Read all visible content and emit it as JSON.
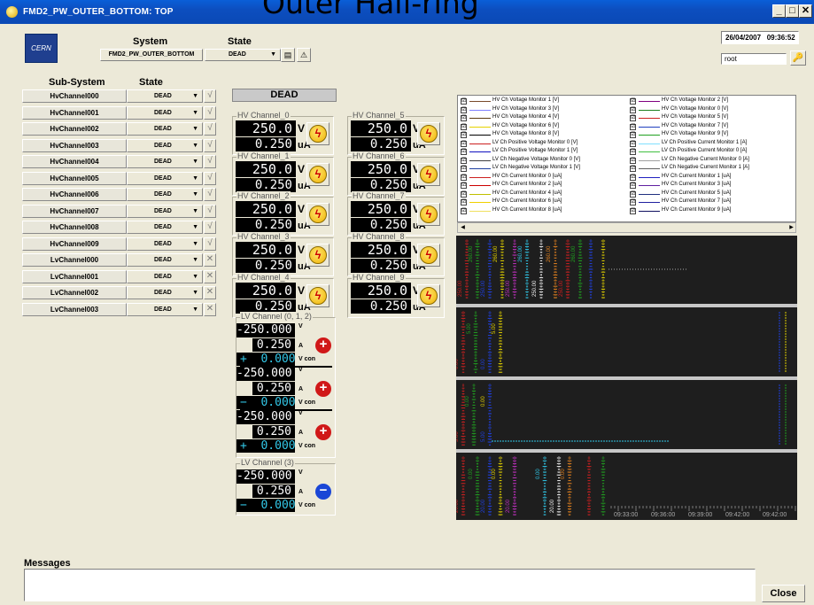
{
  "window": {
    "title": "FMD2_PW_OUTER_BOTTOM: TOP",
    "overlay_title": "Outer Half-ring",
    "min": "_",
    "max": "□",
    "close": "✕"
  },
  "header": {
    "system_label": "System",
    "state_label": "State",
    "system_value": "FMD2_PW_OUTER_BOTTOM",
    "state_value": "DEAD",
    "date": "26/04/2007",
    "time": "09:36:52",
    "user": "root",
    "logo_text": "CERN"
  },
  "subsystems": {
    "col_label": "Sub-System",
    "state_col_label": "State",
    "rows": [
      {
        "name": "HvChannel000",
        "state": "DEAD",
        "mark": "√"
      },
      {
        "name": "HvChannel001",
        "state": "DEAD",
        "mark": "√"
      },
      {
        "name": "HvChannel002",
        "state": "DEAD",
        "mark": "√"
      },
      {
        "name": "HvChannel003",
        "state": "DEAD",
        "mark": "√"
      },
      {
        "name": "HvChannel004",
        "state": "DEAD",
        "mark": "√"
      },
      {
        "name": "HvChannel005",
        "state": "DEAD",
        "mark": "√"
      },
      {
        "name": "HvChannel006",
        "state": "DEAD",
        "mark": "√"
      },
      {
        "name": "HvChannel007",
        "state": "DEAD",
        "mark": "√"
      },
      {
        "name": "HvChannel008",
        "state": "DEAD",
        "mark": "√"
      },
      {
        "name": "HvChannel009",
        "state": "DEAD",
        "mark": "√"
      },
      {
        "name": "LvChannel000",
        "state": "DEAD",
        "mark": "✕"
      },
      {
        "name": "LvChannel001",
        "state": "DEAD",
        "mark": "✕"
      },
      {
        "name": "LvChannel002",
        "state": "DEAD",
        "mark": "✕"
      },
      {
        "name": "LvChannel003",
        "state": "DEAD",
        "mark": "✕"
      }
    ]
  },
  "status_banner": "DEAD",
  "hv_channels": [
    {
      "title": "HV Channel_0",
      "voltage": "250.0",
      "current": "0.250",
      "v_unit": "V",
      "i_unit": "uA"
    },
    {
      "title": "HV Channel_5",
      "voltage": "250.0",
      "current": "0.250",
      "v_unit": "V",
      "i_unit": "uA"
    },
    {
      "title": "HV Channel_1",
      "voltage": "250.0",
      "current": "0.250",
      "v_unit": "V",
      "i_unit": "uA"
    },
    {
      "title": "HV Channel_6",
      "voltage": "250.0",
      "current": "0.250",
      "v_unit": "V",
      "i_unit": "uA"
    },
    {
      "title": "HV Channel_2",
      "voltage": "250.0",
      "current": "0.250",
      "v_unit": "V",
      "i_unit": "uA"
    },
    {
      "title": "HV Channel_7",
      "voltage": "250.0",
      "current": "0.250",
      "v_unit": "V",
      "i_unit": "uA"
    },
    {
      "title": "HV Channel_3",
      "voltage": "250.0",
      "current": "0.250",
      "v_unit": "V",
      "i_unit": "uA"
    },
    {
      "title": "HV Channel_8",
      "voltage": "250.0",
      "current": "0.250",
      "v_unit": "V",
      "i_unit": "uA"
    },
    {
      "title": "HV Channel_4",
      "voltage": "250.0",
      "current": "0.250",
      "v_unit": "V",
      "i_unit": "uA"
    },
    {
      "title": "HV Channel_9",
      "voltage": "250.0",
      "current": "0.250",
      "v_unit": "V",
      "i_unit": "uA"
    }
  ],
  "lv_group_a": {
    "title": "LV Channel (0, 1, 2)",
    "rows": [
      {
        "voltage": "-250.000",
        "current": "0.250",
        "con_sign": "+",
        "con": "0.000"
      },
      {
        "voltage": "-250.000",
        "current": "0.250",
        "con_sign": "−",
        "con": "0.000"
      },
      {
        "voltage": "-250.000",
        "current": "0.250",
        "con_sign": "+",
        "con": "0.000"
      }
    ],
    "v_unit": "V",
    "a_unit": "A",
    "con_unit": "V con"
  },
  "lv_group_b": {
    "title": "LV Channel (3)",
    "rows": [
      {
        "voltage": "-250.000",
        "current": "0.250",
        "con_sign": "−",
        "con": "0.000"
      }
    ],
    "v_unit": "V",
    "a_unit": "A",
    "con_unit": "V con"
  },
  "legend": {
    "left": [
      {
        "label": "HV Ch Voltage Monitor 1 [V]",
        "color": "#7a4a2a"
      },
      {
        "label": "HV Ch Voltage Monitor 3 [V]",
        "color": "#8080ff"
      },
      {
        "label": "HV Ch Voltage Monitor 4 [V]",
        "color": "#5a3a10"
      },
      {
        "label": "HV Ch Voltage Monitor 6 [V]",
        "color": "#e6d200"
      },
      {
        "label": "HV Ch Voltage Monitor 8 [V]",
        "color": "#000000"
      },
      {
        "label": "LV Ch Positive Voltage Monitor 0 [V]",
        "color": "#cc2020"
      },
      {
        "label": "LV Ch Positive Voltage Monitor 1 [V]",
        "color": "#1010c0"
      },
      {
        "label": "LV Ch Negative Voltage Monitor 0 [V]",
        "color": "#404040"
      },
      {
        "label": "LV Ch Negative Voltage Monitor 1 [V]",
        "color": "#2040a0"
      },
      {
        "label": "HV Ch Current Monitor 0 [uA]",
        "color": "#cc2020"
      },
      {
        "label": "HV Ch Current Monitor 2 [uA]",
        "color": "#cc0000"
      },
      {
        "label": "HV Ch Current Monitor 4 [uA]",
        "color": "#c0c000"
      },
      {
        "label": "HV Ch Current Monitor 6 [uA]",
        "color": "#f0d000"
      },
      {
        "label": "HV Ch Current Monitor 8 [uA]",
        "color": "#f0e060"
      }
    ],
    "right": [
      {
        "label": "HV Ch Voltage Monitor 2 [V]",
        "color": "#800080"
      },
      {
        "label": "HV Ch Voltage Monitor 0 [V]",
        "color": "#208020"
      },
      {
        "label": "HV Ch Voltage Monitor 5 [V]",
        "color": "#cc2020"
      },
      {
        "label": "HV Ch Voltage Monitor 7 [V]",
        "color": "#2040c0"
      },
      {
        "label": "HV Ch Voltage Monitor 9 [V]",
        "color": "#20a020"
      },
      {
        "label": "LV Ch Positive Current Monitor 1 [A]",
        "color": "#80e0ff"
      },
      {
        "label": "LV Ch Positive Current Monitor 0 [A]",
        "color": "#40c040"
      },
      {
        "label": "LV Ch Negative Current Monitor 0 [A]",
        "color": "#a0a0a0"
      },
      {
        "label": "LV Ch Negative Current Monitor 1 [A]",
        "color": "#606060"
      },
      {
        "label": "HV Ch Current Monitor 1 [uA]",
        "color": "#2020c0"
      },
      {
        "label": "HV Ch Current Monitor 3 [uA]",
        "color": "#6020a0"
      },
      {
        "label": "HV Ch Current Monitor 5 [uA]",
        "color": "#203080"
      },
      {
        "label": "HV Ch Current Monitor 7 [uA]",
        "color": "#2020a0"
      },
      {
        "label": "HV Ch Current Monitor 9 [uA]",
        "color": "#101060"
      }
    ],
    "check": "☑"
  },
  "plots": {
    "p1_ticks": [
      "250.00",
      "260.00",
      "250.00",
      "260.00",
      "250.00",
      "260.00",
      "250.00",
      "260.00",
      "250.00",
      "260.00"
    ],
    "p2_ticks": [
      "0.00",
      "5.00",
      "0.00",
      "5.00"
    ],
    "p3_ticks": [
      "5.00",
      "0.00",
      "5.00",
      "0.00"
    ],
    "p4_ticks": [
      "20.00",
      "0.00",
      "20.00",
      "0.00",
      "20.00",
      "0.00",
      "20.00",
      "0.00"
    ],
    "time_labels": [
      "09:33:00",
      "09:36:00",
      "09:39:00",
      "09:42:00",
      "09:42:00"
    ]
  },
  "messages": {
    "label": "Messages",
    "text": ""
  },
  "close_button": "Close"
}
